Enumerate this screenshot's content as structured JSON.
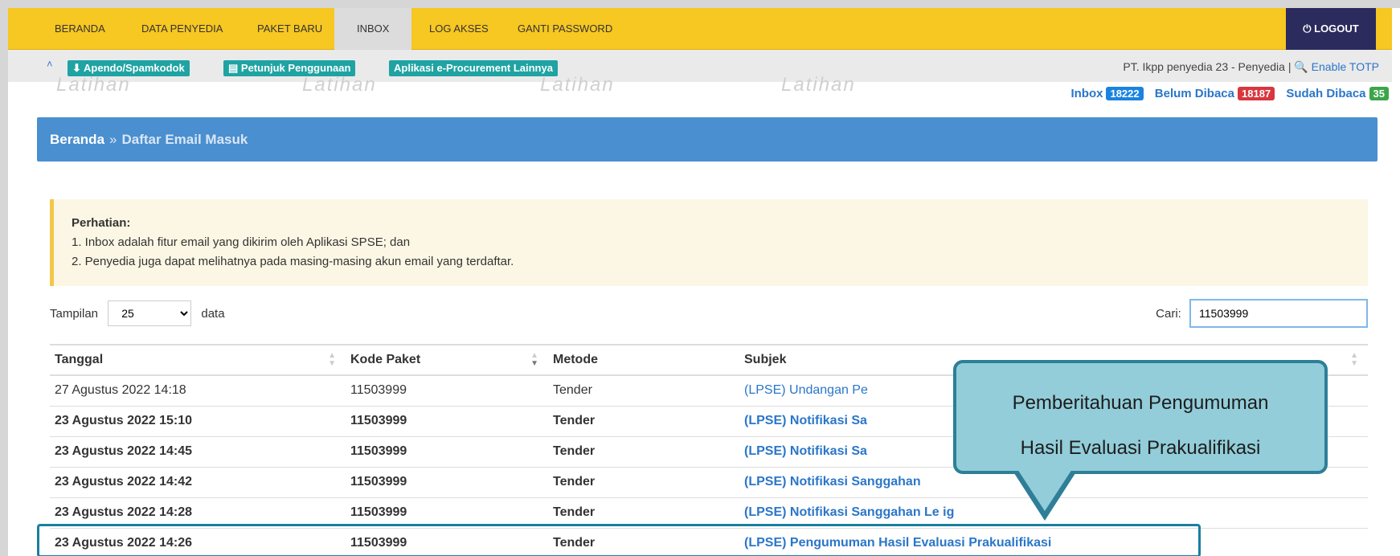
{
  "nav": {
    "items": [
      "BERANDA",
      "DATA PENYEDIA",
      "PAKET BARU",
      "INBOX",
      "LOG AKSES",
      "GANTI PASSWORD"
    ],
    "active": "INBOX",
    "logout": "⏻ LOGOUT"
  },
  "subbar": {
    "apendo": "⬇ Apendo/Spamkodok",
    "petunjuk": "▤ Petunjuk Penggunaan",
    "lainnya": "Aplikasi e-Procurement Lainnya",
    "user": "PT. Ikpp penyedia 23 - Penyedia | ",
    "totp": "🔍 Enable TOTP"
  },
  "watermark": "Latihan",
  "counts": {
    "inbox_label": "Inbox",
    "inbox": "18222",
    "unread_label": "Belum Dibaca",
    "unread": "18187",
    "read_label": "Sudah Dibaca",
    "read": "35"
  },
  "breadcrumb": {
    "home": "Beranda",
    "sep": "»",
    "current": "Daftar Email Masuk"
  },
  "alert": {
    "title": "Perhatian:",
    "line1": "1. Inbox adalah fitur email yang dikirim oleh Aplikasi SPSE; dan",
    "line2": "2. Penyedia juga dapat melihatnya pada masing-masing akun email yang terdaftar."
  },
  "controls": {
    "tampilan": "Tampilan",
    "page_size": "25",
    "data_label": "data",
    "cari": "Cari:",
    "search_value": "11503999"
  },
  "table": {
    "headers": [
      "Tanggal",
      "Kode Paket",
      "Metode",
      "Subjek"
    ],
    "rows": [
      [
        "27 Agustus 2022 14:18",
        "11503999",
        "Tender",
        "(LPSE) Undangan Pe"
      ],
      [
        "23 Agustus 2022 15:10",
        "11503999",
        "Tender",
        "(LPSE) Notifikasi Sa"
      ],
      [
        "23 Agustus 2022 14:45",
        "11503999",
        "Tender",
        "(LPSE) Notifikasi Sa"
      ],
      [
        "23 Agustus 2022 14:42",
        "11503999",
        "Tender",
        "(LPSE) Notifikasi Sanggahan"
      ],
      [
        "23 Agustus 2022 14:28",
        "11503999",
        "Tender",
        "(LPSE) Notifikasi Sanggahan Le    ig"
      ],
      [
        "23 Agustus 2022 14:26",
        "11503999",
        "Tender",
        "(LPSE) Pengumuman Hasil Evaluasi Prakualifikasi"
      ]
    ]
  },
  "callout": {
    "line1": "Pemberitahuan Pengumuman",
    "line2": "Hasil Evaluasi Prakualifikasi"
  },
  "colors": {
    "nav": "#f7c722",
    "crumb": "#4a8fcf",
    "teal": "#1fa3a3",
    "callout": "#92cdd9"
  }
}
